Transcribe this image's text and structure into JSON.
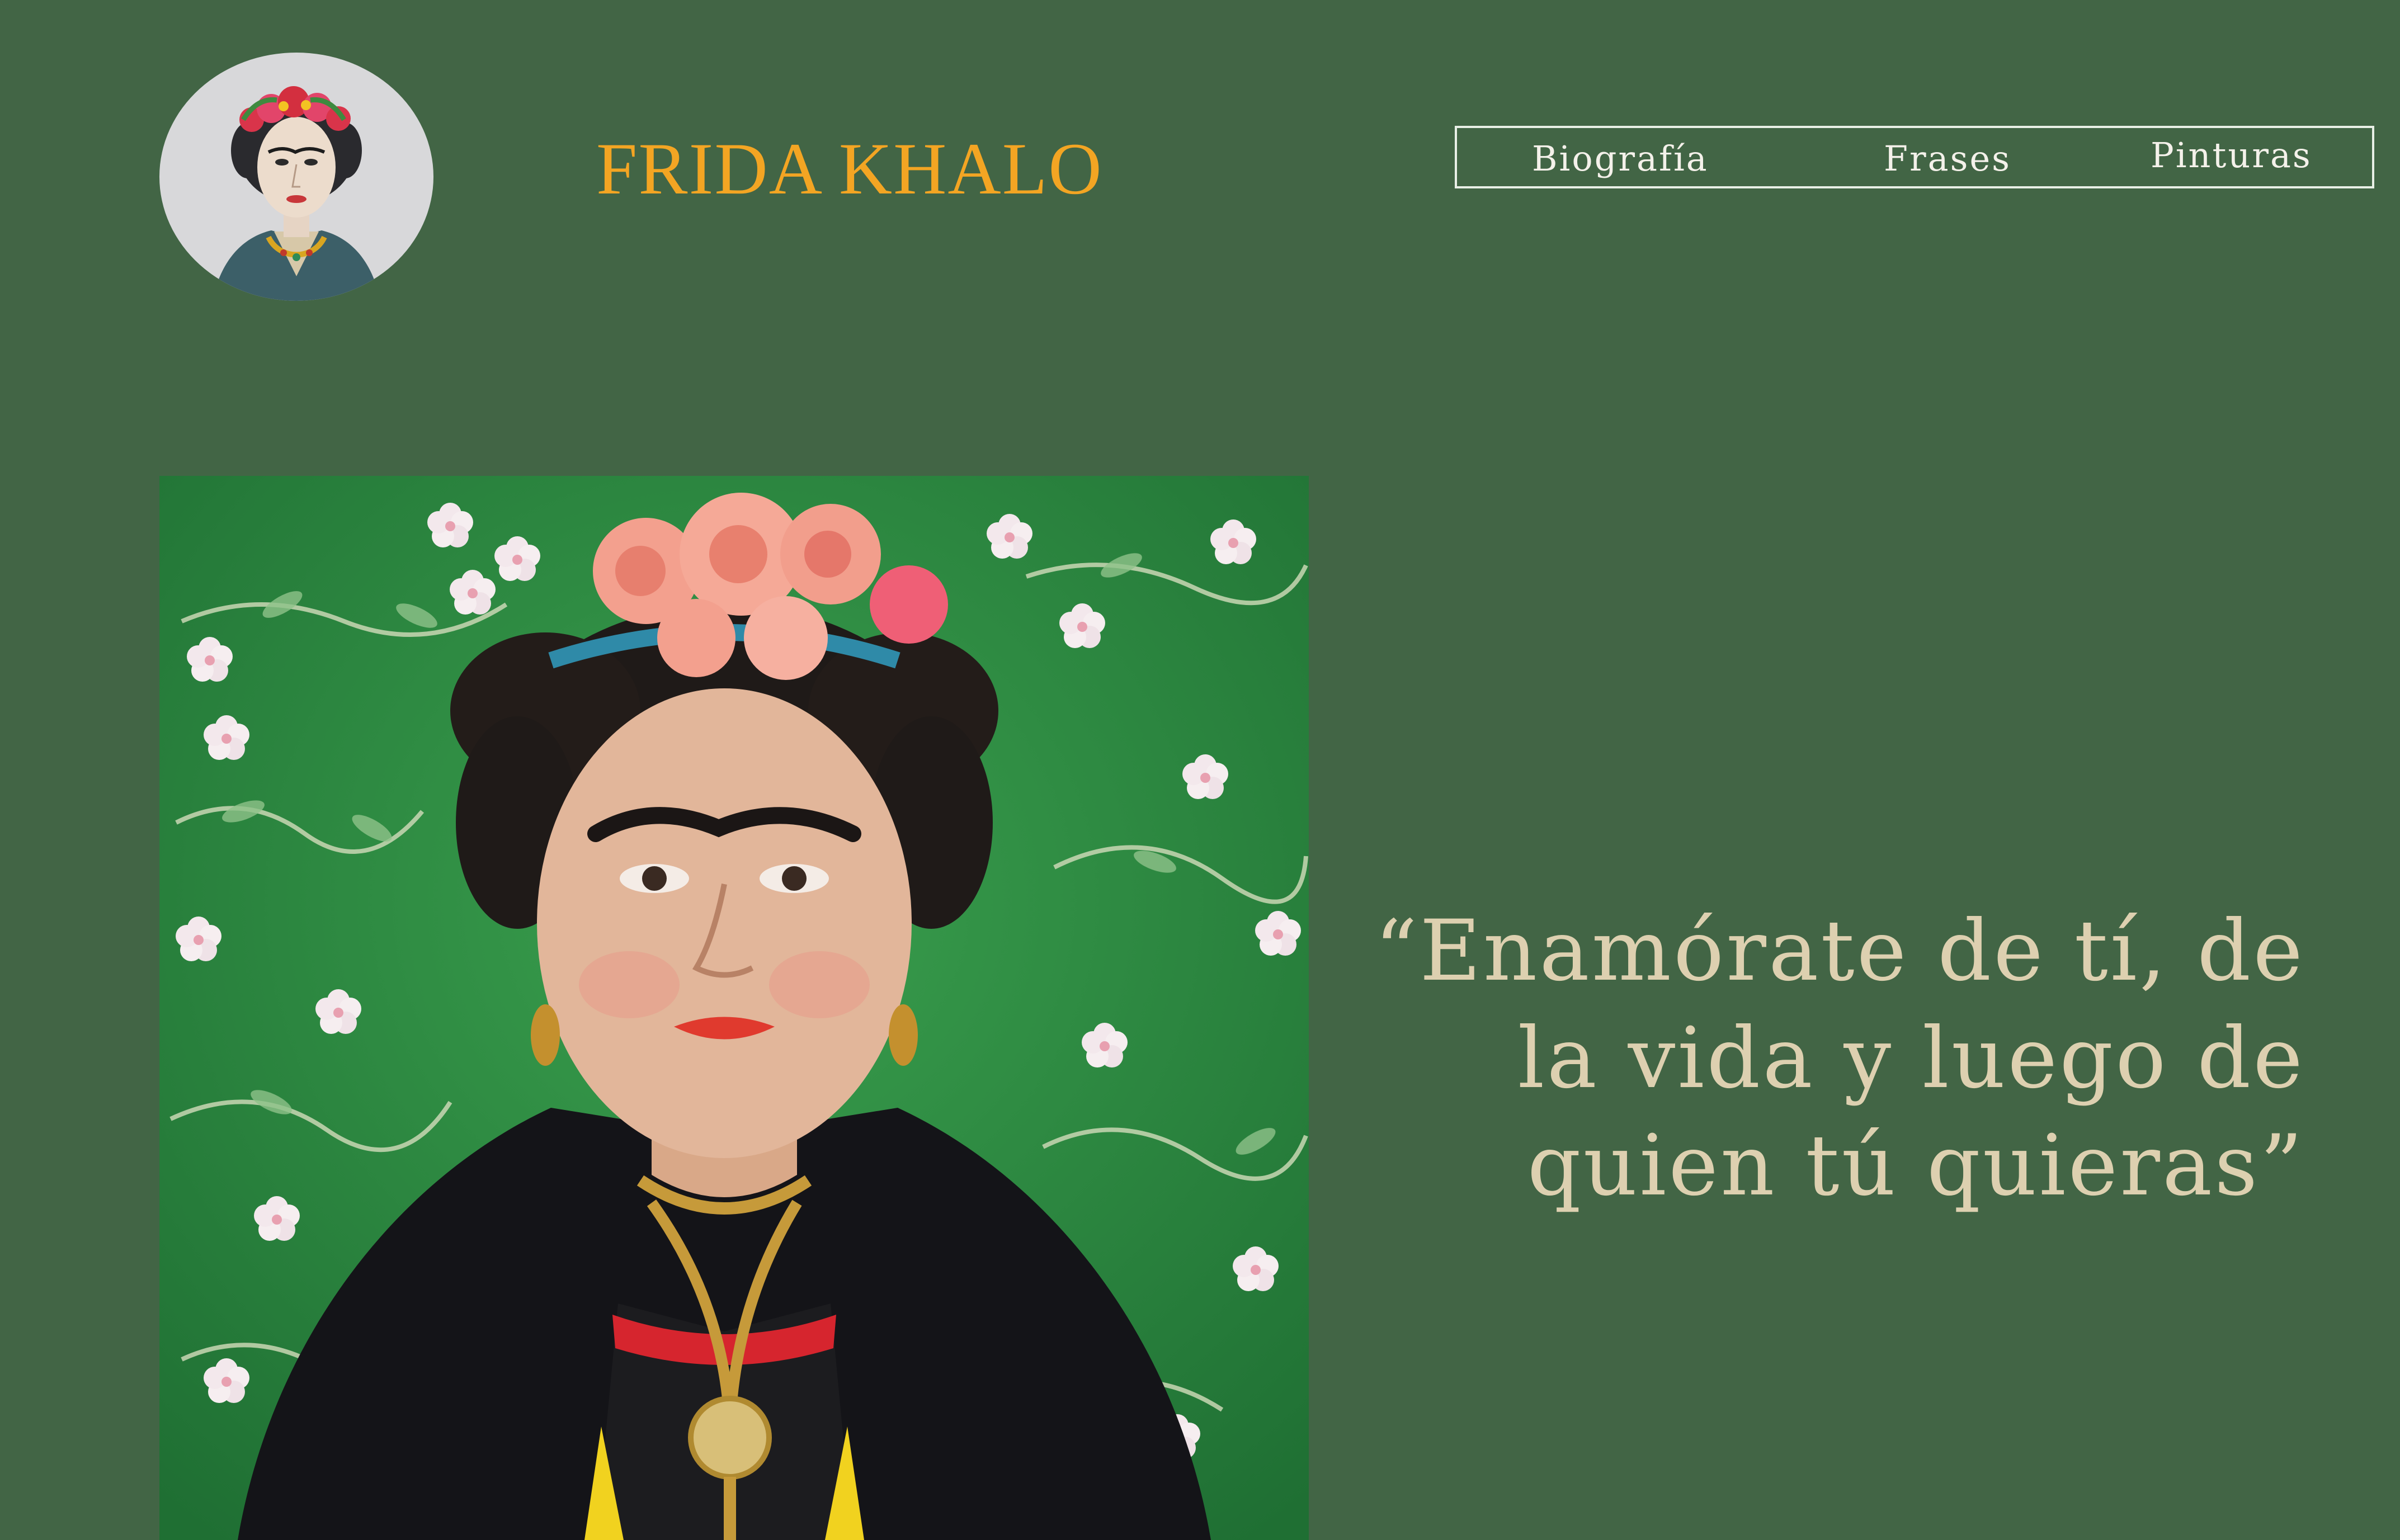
{
  "header": {
    "title": "FRIDA KHALO",
    "logo_icon": "frida-watercolor-portrait-logo"
  },
  "nav": {
    "items": [
      {
        "label": "Biografía"
      },
      {
        "label": "Frases"
      },
      {
        "label": "Pinturas"
      }
    ]
  },
  "hero": {
    "image": "frida-kahlo-portrait-photo",
    "quote": "“Enamórate de tí, de la vida y luego de quien tú quieras”"
  },
  "colors": {
    "background": "#426545",
    "title": "#f3a523",
    "nav_text": "#f4f1ea",
    "nav_border": "#e8efe6",
    "quote": "#ddd0b0",
    "logo_bg": "#d8d8da"
  }
}
